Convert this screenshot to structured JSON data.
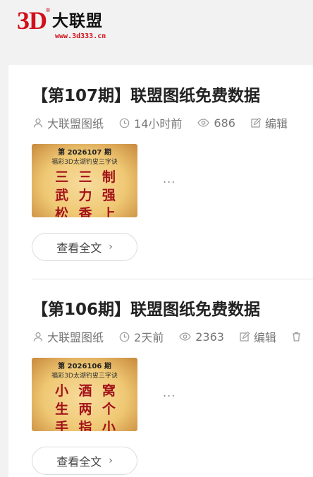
{
  "site": {
    "logo_mark": "3D",
    "logo_reg": "®",
    "logo_name": "大联盟",
    "logo_url": "www.3d333.cn"
  },
  "colors": {
    "brand_red": "#d0101a",
    "card_bg": "#ffffff",
    "page_bg": "#f2f2f2"
  },
  "posts": [
    {
      "title": "【第107期】联盟图纸免费数据",
      "author": "大联盟图纸",
      "time": "14小时前",
      "views": "686",
      "edit_label": "编辑",
      "thumb_issue": "第 2026107 期",
      "thumb_sub": "福彩3D太湖钓叟三字诀",
      "thumb_chars": [
        "三",
        "三",
        "制",
        "武",
        "力",
        "强",
        "松",
        "香",
        "上"
      ],
      "excerpt": "...",
      "read_more": "查看全文"
    },
    {
      "title": "【第106期】联盟图纸免费数据",
      "author": "大联盟图纸",
      "time": "2天前",
      "views": "2363",
      "edit_label": "编辑",
      "thumb_issue": "第 2026106 期",
      "thumb_sub": "福彩3D太湖钓叟三字诀",
      "thumb_chars": [
        "小",
        "酒",
        "窝",
        "生",
        "两",
        "个",
        "手",
        "指",
        "小"
      ],
      "excerpt": "...",
      "read_more": "查看全文"
    }
  ],
  "icons": {
    "author": "user-icon",
    "time": "clock-icon",
    "views": "eye-icon",
    "edit": "edit-icon",
    "extra": "trash-icon",
    "chevron": "chevron-right-icon"
  }
}
